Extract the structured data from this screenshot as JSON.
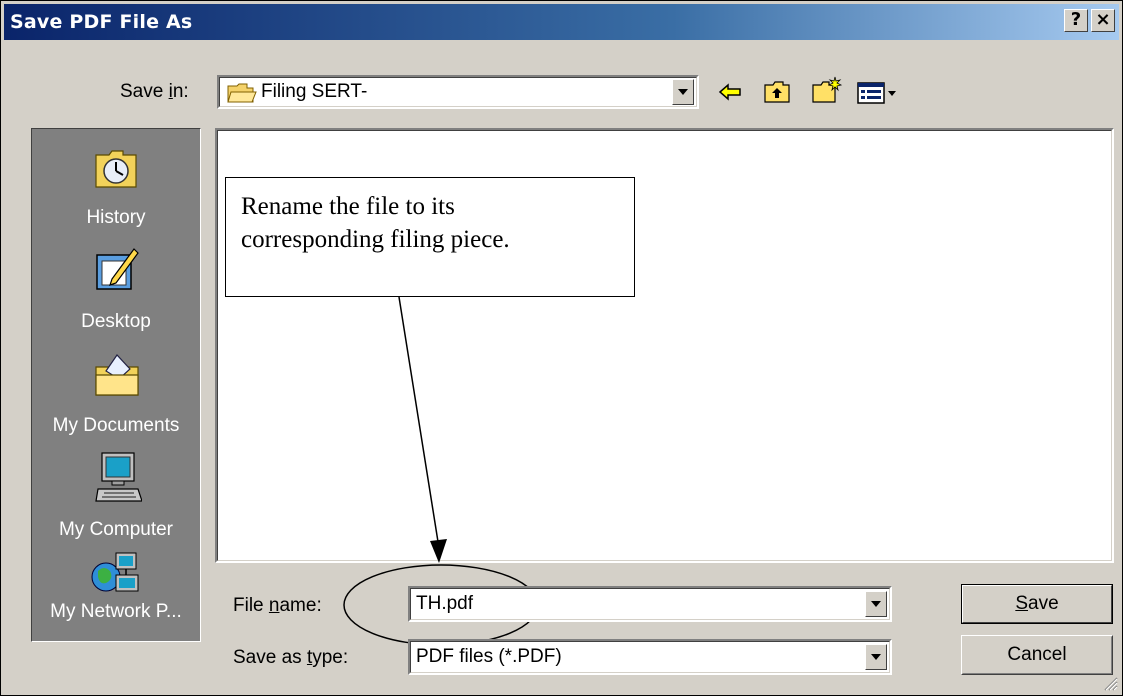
{
  "dialog": {
    "title": "Save PDF File As",
    "help_label": "?",
    "close_label": "×"
  },
  "save_in": {
    "label_pre": "Save ",
    "label_key": "i",
    "label_post": "n:",
    "value": "Filing SERT-"
  },
  "toolbar": {
    "icons": [
      "back-arrow-icon",
      "up-folder-icon",
      "new-folder-icon",
      "view-menu-icon"
    ]
  },
  "places": [
    {
      "label": "History",
      "icon": "history-icon"
    },
    {
      "label": "Desktop",
      "icon": "desktop-icon"
    },
    {
      "label": "My Documents",
      "icon": "my-documents-icon"
    },
    {
      "label": "My Computer",
      "icon": "my-computer-icon"
    },
    {
      "label": "My Network P...",
      "icon": "network-places-icon"
    }
  ],
  "callout": {
    "text_line1": "Rename the file to its",
    "text_line2": "corresponding filing piece."
  },
  "file_name": {
    "label_pre": "File ",
    "label_key": "n",
    "label_post": "ame:",
    "value": "TH.pdf"
  },
  "save_as_type": {
    "label_pre": "Save as ",
    "label_key": "t",
    "label_post": "ype:",
    "value": "PDF files (*.PDF)"
  },
  "buttons": {
    "save_key": "S",
    "save_rest": "ave",
    "cancel": "Cancel"
  },
  "colors": {
    "title_start": "#0a246a",
    "title_end": "#a6caf0",
    "face": "#d4d0c8",
    "places_bg": "#808080"
  }
}
